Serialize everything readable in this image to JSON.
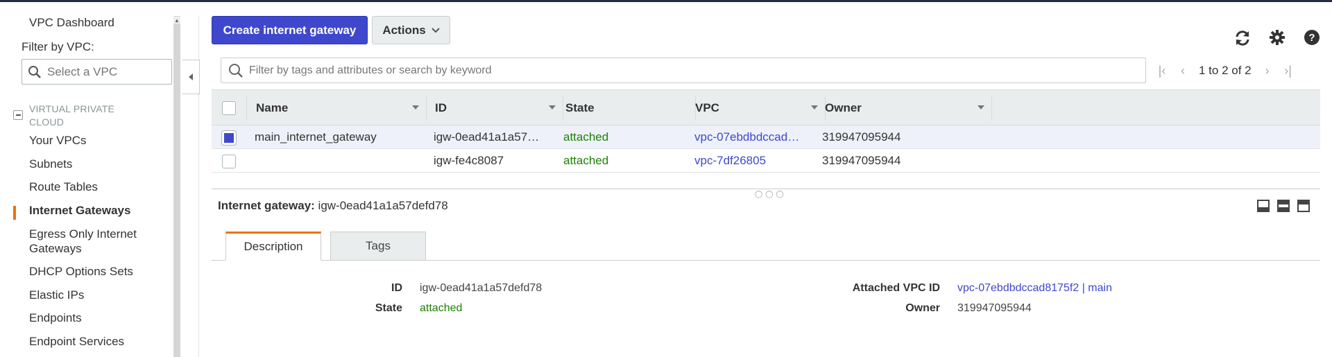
{
  "sidebar": {
    "dashboard": "VPC Dashboard",
    "filter_label": "Filter by VPC:",
    "filter_placeholder": "Select a VPC",
    "section_title": "VIRTUAL PRIVATE CLOUD",
    "items": [
      {
        "label": "Your VPCs"
      },
      {
        "label": "Subnets"
      },
      {
        "label": "Route Tables"
      },
      {
        "label": "Internet Gateways",
        "active": true
      },
      {
        "label": "Egress Only Internet Gateways"
      },
      {
        "label": "DHCP Options Sets"
      },
      {
        "label": "Elastic IPs"
      },
      {
        "label": "Endpoints"
      },
      {
        "label": "Endpoint Services"
      }
    ]
  },
  "toolbar": {
    "create_label": "Create internet gateway",
    "actions_label": "Actions"
  },
  "search": {
    "placeholder": "Filter by tags and attributes or search by keyword"
  },
  "pager": {
    "count": "1 to 2 of 2"
  },
  "table": {
    "columns": [
      "Name",
      "ID",
      "State",
      "VPC",
      "Owner"
    ],
    "rows": [
      {
        "name": "main_internet_gateway",
        "id": "igw-0ead41a1a57…",
        "state": "attached",
        "vpc": "vpc-07ebdbdccad…",
        "owner": "319947095944",
        "selected": true
      },
      {
        "name": "",
        "id": "igw-fe4c8087",
        "state": "attached",
        "vpc": "vpc-7df26805",
        "owner": "319947095944",
        "selected": false
      }
    ]
  },
  "details": {
    "title_label": "Internet gateway:",
    "title_value": "igw-0ead41a1a57defd78",
    "tabs": [
      "Description",
      "Tags"
    ],
    "fields": {
      "id_label": "ID",
      "id_value": "igw-0ead41a1a57defd78",
      "state_label": "State",
      "state_value": "attached",
      "vpc_label": "Attached VPC ID",
      "vpc_value": "vpc-07ebdbdccad8175f2 | main",
      "owner_label": "Owner",
      "owner_value": "319947095944"
    }
  },
  "colors": {
    "primary": "#3f48cc",
    "accent": "#ec7211",
    "success": "#1d8102"
  },
  "icons": [
    "search-icon",
    "refresh-icon",
    "gear-icon",
    "help-icon",
    "chevron-down-icon",
    "first-page-icon",
    "prev-page-icon",
    "next-page-icon",
    "last-page-icon",
    "collapse-left-icon"
  ]
}
